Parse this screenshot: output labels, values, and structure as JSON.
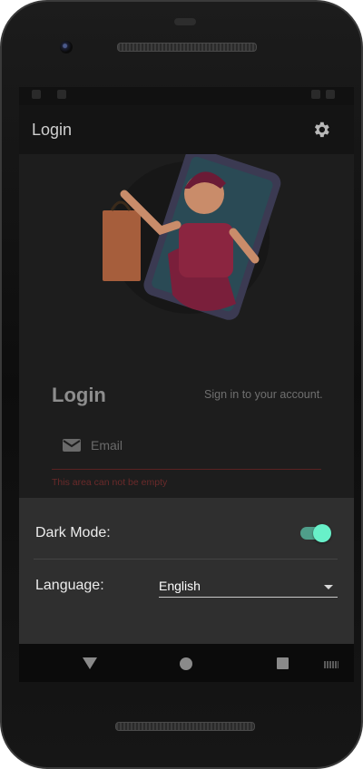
{
  "appbar": {
    "title": "Login",
    "settings_icon": "gear-icon"
  },
  "login": {
    "title": "Login",
    "subtitle": "Sign in to your account.",
    "email_placeholder": "Email",
    "email_icon": "mail-icon",
    "error": "This area can not be empty"
  },
  "settings_sheet": {
    "dark_mode_label": "Dark Mode:",
    "dark_mode_on": true,
    "language_label": "Language:",
    "language_value": "English"
  },
  "colors": {
    "accent": "#68f0c9",
    "error": "#6a2a2a",
    "sheet_bg": "#2f2f2f"
  },
  "navbar": {
    "icons": [
      "back-icon",
      "home-icon",
      "recents-icon",
      "keyboard-icon"
    ]
  }
}
